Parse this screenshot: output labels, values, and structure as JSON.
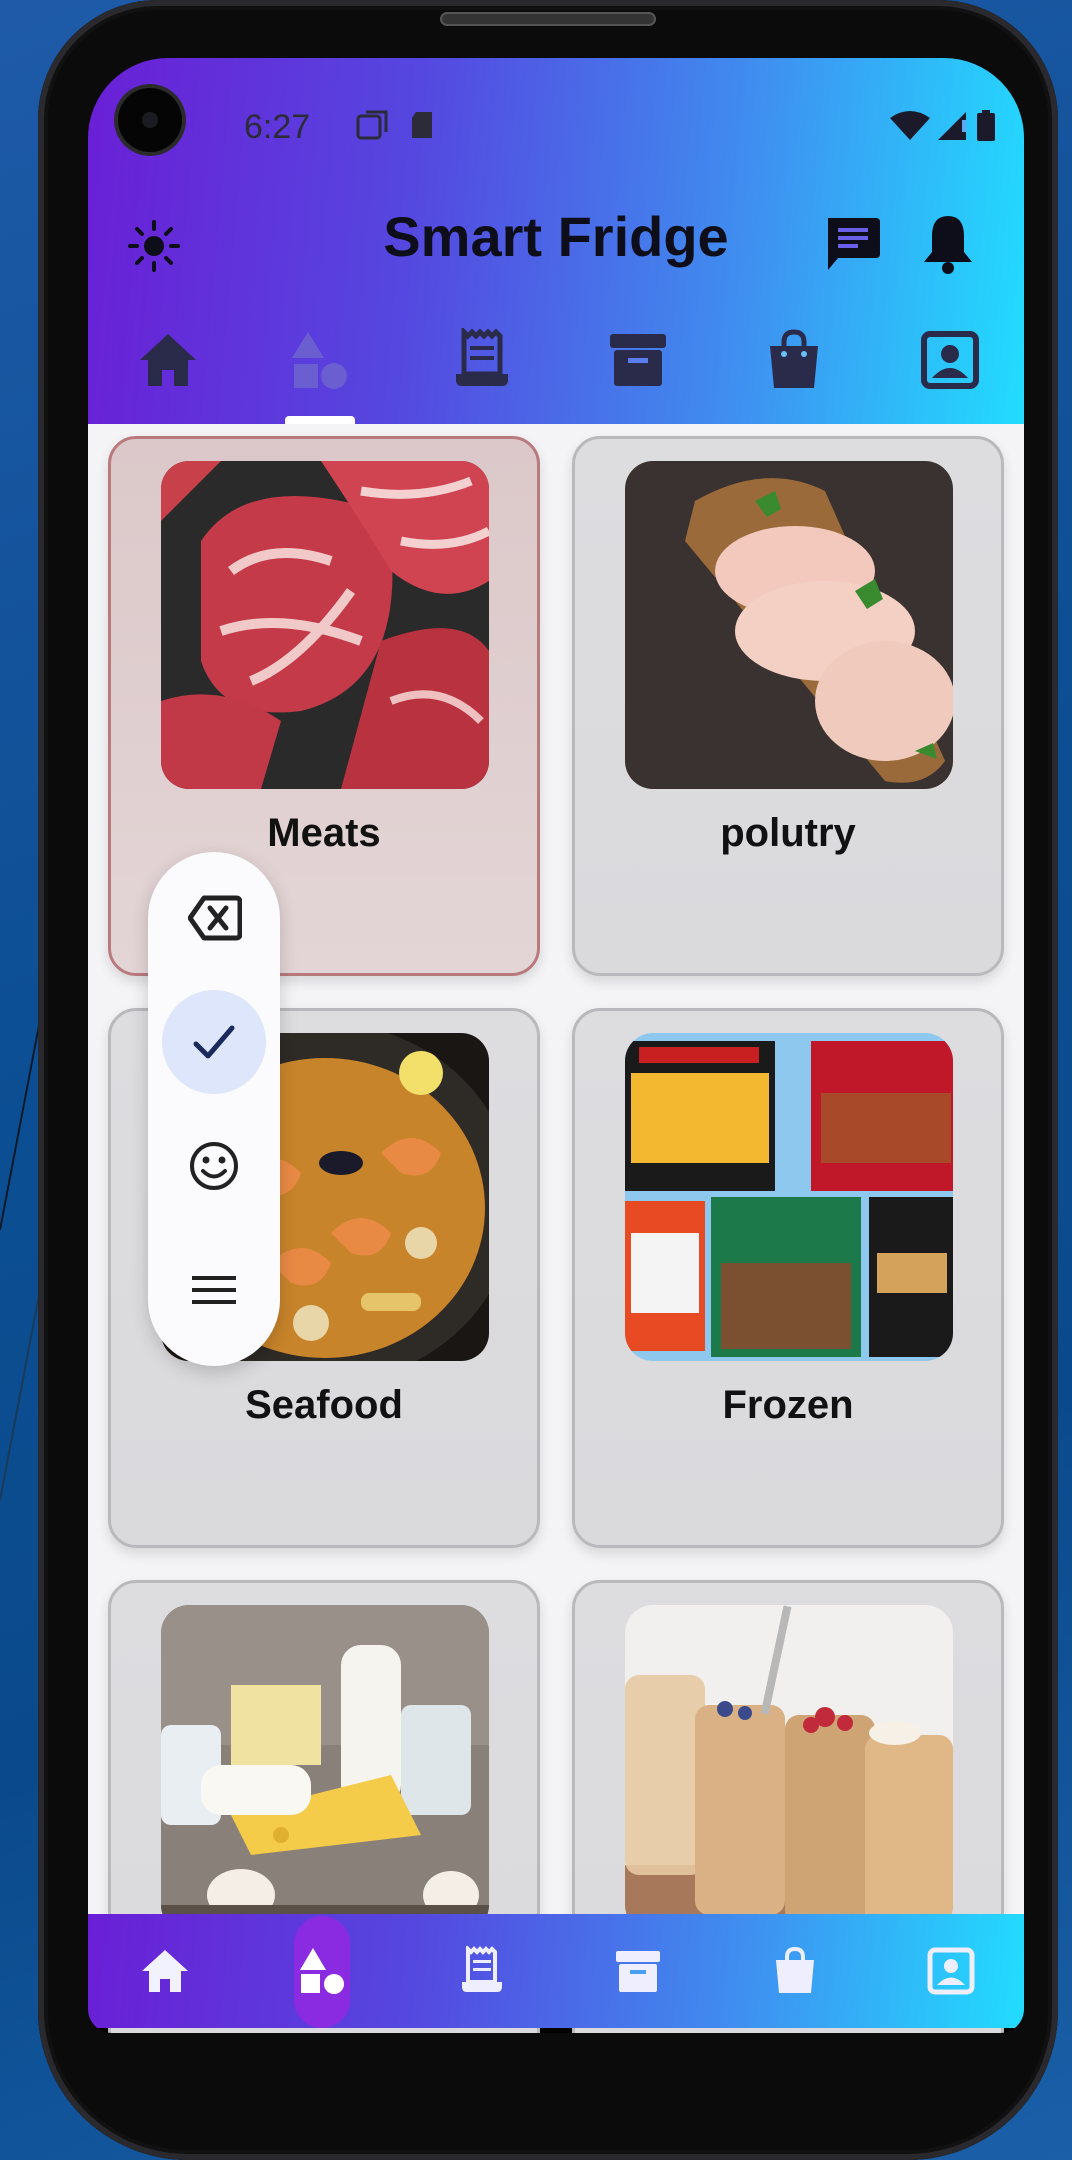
{
  "status_bar": {
    "time": "6:27"
  },
  "header": {
    "title": "Smart Fridge"
  },
  "top_tabs": [
    {
      "name": "home",
      "icon": "home-icon"
    },
    {
      "name": "categories",
      "icon": "shapes-icon",
      "active": true
    },
    {
      "name": "receipts",
      "icon": "receipt-icon"
    },
    {
      "name": "storage",
      "icon": "archive-icon"
    },
    {
      "name": "shopping",
      "icon": "shopping-bag-icon"
    },
    {
      "name": "profile",
      "icon": "profile-icon"
    }
  ],
  "categories": [
    {
      "label": "Meats",
      "selected": true
    },
    {
      "label": "polutry"
    },
    {
      "label": "Seafood"
    },
    {
      "label": "Frozen"
    },
    {
      "label": ""
    },
    {
      "label": ""
    }
  ],
  "floating_menu": [
    {
      "icon": "backspace-icon"
    },
    {
      "icon": "check-icon",
      "active": true
    },
    {
      "icon": "emoji-icon"
    },
    {
      "icon": "menu-icon"
    }
  ],
  "colors": {
    "gradient_start": "#6a1fd6",
    "gradient_end": "#22dcff",
    "active_pill": "#8a2be2"
  }
}
